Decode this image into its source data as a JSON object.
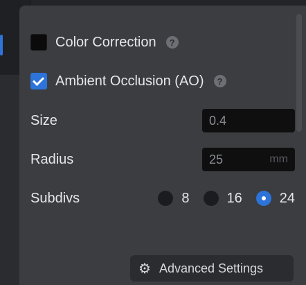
{
  "panel": {
    "color_correction": {
      "label": "Color Correction",
      "checked": false,
      "help_icon": "question-icon"
    },
    "ambient_occlusion": {
      "label": "Ambient Occlusion (AO)",
      "checked": true,
      "help_icon": "question-icon"
    },
    "size": {
      "label": "Size",
      "value": "0.4"
    },
    "radius": {
      "label": "Radius",
      "value": "25",
      "unit": "mm"
    },
    "subdivs": {
      "label": "Subdivs",
      "options": [
        "8",
        "16",
        "24"
      ],
      "selected": "24"
    },
    "advanced_settings": {
      "label": "Advanced Settings",
      "icon": "gear-icon"
    }
  },
  "colors": {
    "accent": "#2c74d9",
    "panel_bg": "#3b3d40",
    "field_bg": "#0f0f10"
  }
}
